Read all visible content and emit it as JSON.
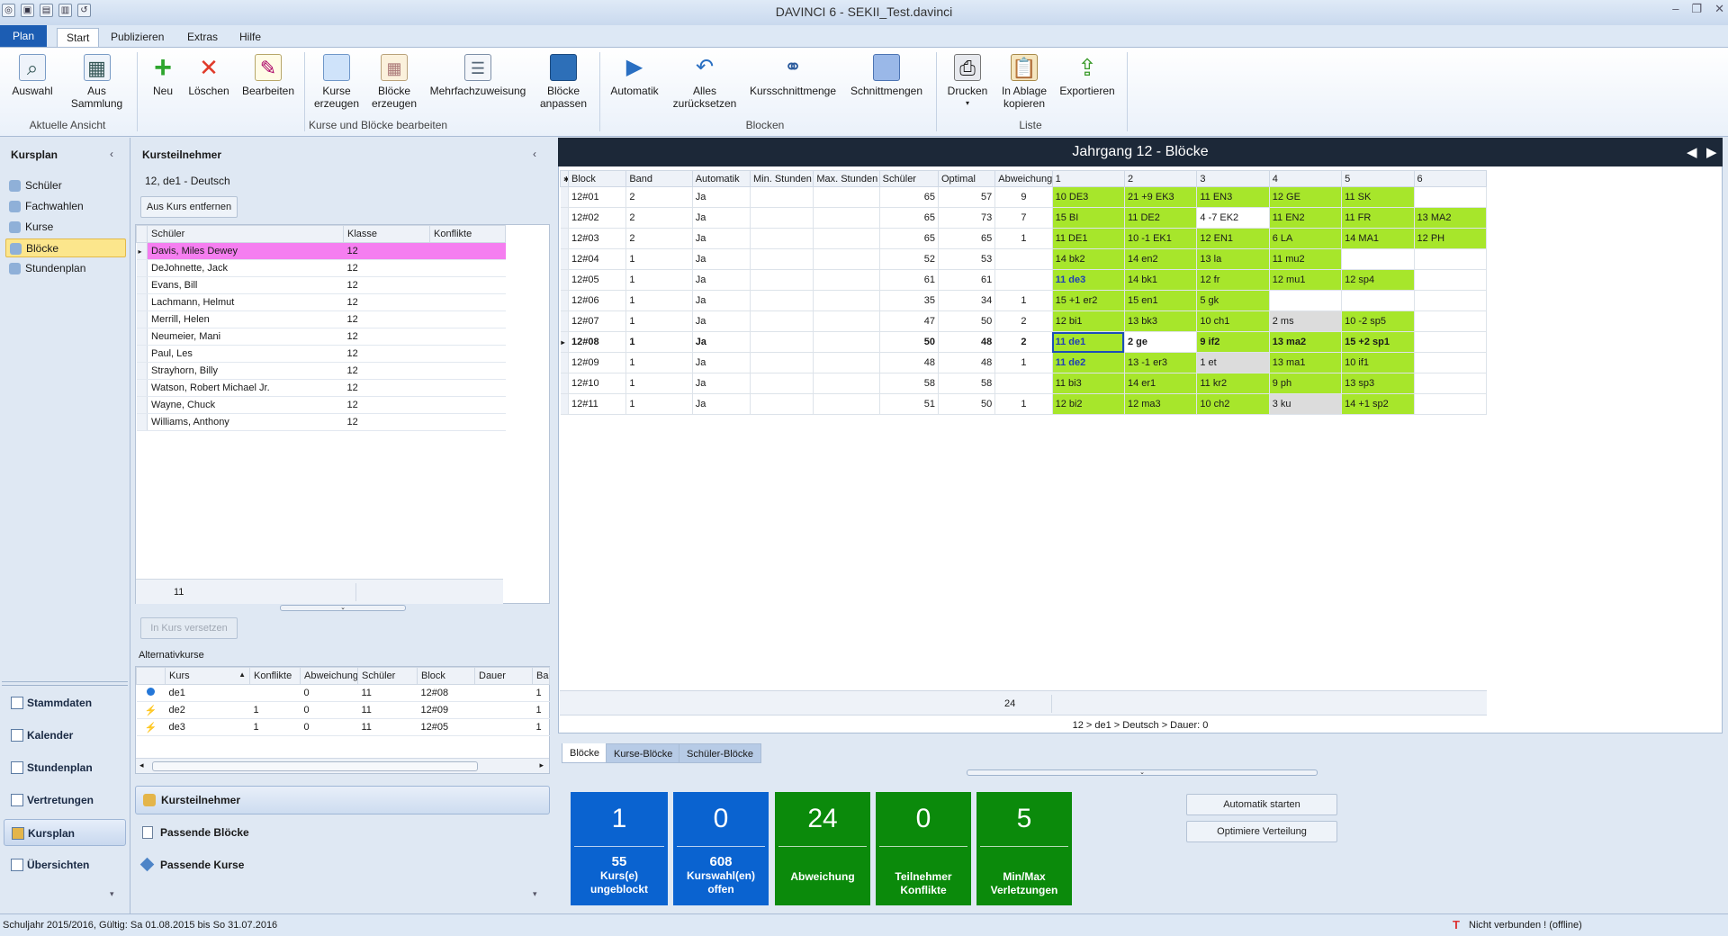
{
  "window": {
    "title": "DAVINCI 6 - SEKII_Test.davinci"
  },
  "menu": {
    "plan": "Plan",
    "tabs": [
      "Start",
      "Publizieren",
      "Extras",
      "Hilfe"
    ]
  },
  "ribbon": {
    "buttons": {
      "auswahl": "Auswahl",
      "aus_sammlung": "Aus\nSammlung",
      "neu": "Neu",
      "loeschen": "Löschen",
      "bearbeiten": "Bearbeiten",
      "kurse_erzeugen": "Kurse\nerzeugen",
      "bloecke_erzeugen": "Blöcke\nerzeugen",
      "mehrfachzuweisung": "Mehrfachzuweisung",
      "bloecke_anpassen": "Blöcke\nanpassen",
      "automatik": "Automatik",
      "alles_zuruecksetzen": "Alles\nzurücksetzen",
      "kursschnittmenge": "Kursschnittmenge",
      "schnittmengen": "Schnittmengen",
      "drucken": "Drucken",
      "in_ablage_kopieren": "In Ablage\nkopieren",
      "exportieren": "Exportieren"
    },
    "groups": {
      "aktuelle_ansicht": "Aktuelle Ansicht",
      "kurse_bloecke": "Kurse und Blöcke bearbeiten",
      "blocken": "Blocken",
      "liste": "Liste"
    }
  },
  "nav": {
    "title": "Kursplan",
    "items": [
      "Schüler",
      "Fachwahlen",
      "Kurse",
      "Blöcke",
      "Stundenplan"
    ],
    "bottom": [
      "Stammdaten",
      "Kalender",
      "Stundenplan",
      "Vertretungen",
      "Kursplan",
      "Übersichten"
    ]
  },
  "mid": {
    "title": "Kursteilnehmer",
    "course": "12, de1 - Deutsch",
    "remove_btn": "Aus Kurs entfernen",
    "cols": [
      "Schüler",
      "Klasse",
      "Konflikte"
    ],
    "students": [
      [
        "Davis, Miles Dewey",
        "12",
        ""
      ],
      [
        "DeJohnette, Jack",
        "12",
        ""
      ],
      [
        "Evans, Bill",
        "12",
        ""
      ],
      [
        "Lachmann, Helmut",
        "12",
        ""
      ],
      [
        "Merrill, Helen",
        "12",
        ""
      ],
      [
        "Neumeier, Mani",
        "12",
        ""
      ],
      [
        "Paul, Les",
        "12",
        ""
      ],
      [
        "Strayhorn, Billy",
        "12",
        ""
      ],
      [
        "Watson, Robert Michael Jr.",
        "12",
        ""
      ],
      [
        "Wayne, Chuck",
        "12",
        ""
      ],
      [
        "Williams, Anthony",
        "12",
        ""
      ]
    ],
    "count": "11",
    "move_btn": "In Kurs versetzen",
    "alt_title": "Alternativkurse",
    "alt_cols": [
      "Kurs",
      "Konflikte",
      "Abweichung",
      "Schüler",
      "Block",
      "Dauer",
      "Ban"
    ],
    "alt_rows": [
      [
        "de1",
        "",
        "0",
        "11",
        "12#08",
        "",
        "1"
      ],
      [
        "de2",
        "1",
        "0",
        "11",
        "12#09",
        "",
        "1"
      ],
      [
        "de3",
        "1",
        "0",
        "11",
        "12#05",
        "",
        "1"
      ]
    ],
    "sections": [
      "Kursteilnehmer",
      "Passende Blöcke",
      "Passende Kurse"
    ]
  },
  "main": {
    "header": "Jahrgang 12 - Blöcke",
    "cols": [
      "Block",
      "Band",
      "Automatik",
      "Min. Stunden",
      "Max. Stunden",
      "Schüler",
      "Optimal",
      "Abweichung",
      "1",
      "2",
      "3",
      "4",
      "5",
      "6"
    ],
    "rows": [
      [
        "12#01",
        "2",
        "Ja",
        "",
        "",
        "65",
        "57",
        "9",
        "10 DE3",
        "21 +9 EK3",
        "11 EN3",
        "12 GE",
        "11 SK",
        ""
      ],
      [
        "12#02",
        "2",
        "Ja",
        "",
        "",
        "65",
        "73",
        "7",
        "15 BI",
        "11 DE2",
        "4 -7 EK2",
        "11 EN2",
        "11 FR",
        "13 MA2"
      ],
      [
        "12#03",
        "2",
        "Ja",
        "",
        "",
        "65",
        "65",
        "1",
        "11 DE1",
        "10 -1 EK1",
        "12 EN1",
        "6 LA",
        "14 MA1",
        "12 PH"
      ],
      [
        "12#04",
        "1",
        "Ja",
        "",
        "",
        "52",
        "53",
        "",
        "14 bk2",
        "14 en2",
        "13 la",
        "11 mu2",
        "",
        ""
      ],
      [
        "12#05",
        "1",
        "Ja",
        "",
        "",
        "61",
        "61",
        "",
        "11 de3",
        "14 bk1",
        "12 fr",
        "12 mu1",
        "12 sp4",
        ""
      ],
      [
        "12#06",
        "1",
        "Ja",
        "",
        "",
        "35",
        "34",
        "1",
        "15 +1 er2",
        "15 en1",
        "5 gk",
        "",
        "",
        ""
      ],
      [
        "12#07",
        "1",
        "Ja",
        "",
        "",
        "47",
        "50",
        "2",
        "12 bi1",
        "13 bk3",
        "10 ch1",
        "2 ms",
        "10 -2 sp5",
        ""
      ],
      [
        "12#08",
        "1",
        "Ja",
        "",
        "",
        "50",
        "48",
        "2",
        "11 de1",
        "2 ge",
        "9 if2",
        "13 ma2",
        "15 +2 sp1",
        ""
      ],
      [
        "12#09",
        "1",
        "Ja",
        "",
        "",
        "48",
        "48",
        "1",
        "11 de2",
        "13 -1 er3",
        "1 et",
        "13 ma1",
        "10 if1",
        ""
      ],
      [
        "12#10",
        "1",
        "Ja",
        "",
        "",
        "58",
        "58",
        "",
        "11 bi3",
        "14 er1",
        "11 kr2",
        "9 ph",
        "13 sp3",
        ""
      ],
      [
        "12#11",
        "1",
        "Ja",
        "",
        "",
        "51",
        "50",
        "1",
        "12 bi2",
        "12 ma3",
        "10 ch2",
        "3 ku",
        "14 +1 sp2",
        ""
      ]
    ],
    "footer_sum": "24",
    "path": "12 > de1 > Deutsch > Dauer: 0",
    "tabs": [
      "Blöcke",
      "Kurse-Blöcke",
      "Schüler-Blöcke"
    ]
  },
  "stats": [
    {
      "big": "1",
      "num": "55",
      "label": "Kurs(e)\nungeblockt",
      "color": "#0a63d0"
    },
    {
      "big": "0",
      "num": "608",
      "label": "Kurswahl(en)\noffen",
      "color": "#0a63d0"
    },
    {
      "big": "24",
      "num": "",
      "label": "Abweichung",
      "color": "#0b8a0b"
    },
    {
      "big": "0",
      "num": "",
      "label": "Teilnehmer\nKonflikte",
      "color": "#0b8a0b"
    },
    {
      "big": "5",
      "num": "",
      "label": "Min/Max\nVerletzungen",
      "color": "#0b8a0b"
    }
  ],
  "actions": {
    "start": "Automatik starten",
    "optimize": "Optimiere Verteilung"
  },
  "status": {
    "left": "Schuljahr 2015/2016, Gültig: Sa 01.08.2015 bis So 31.07.2016",
    "right": "Nicht verbunden ! (offline)"
  },
  "colors": {
    "accent": "#1c5db3",
    "green_cell": "#a7e62b",
    "tile_blue": "#0a63d0",
    "tile_green": "#0b8a0b"
  }
}
